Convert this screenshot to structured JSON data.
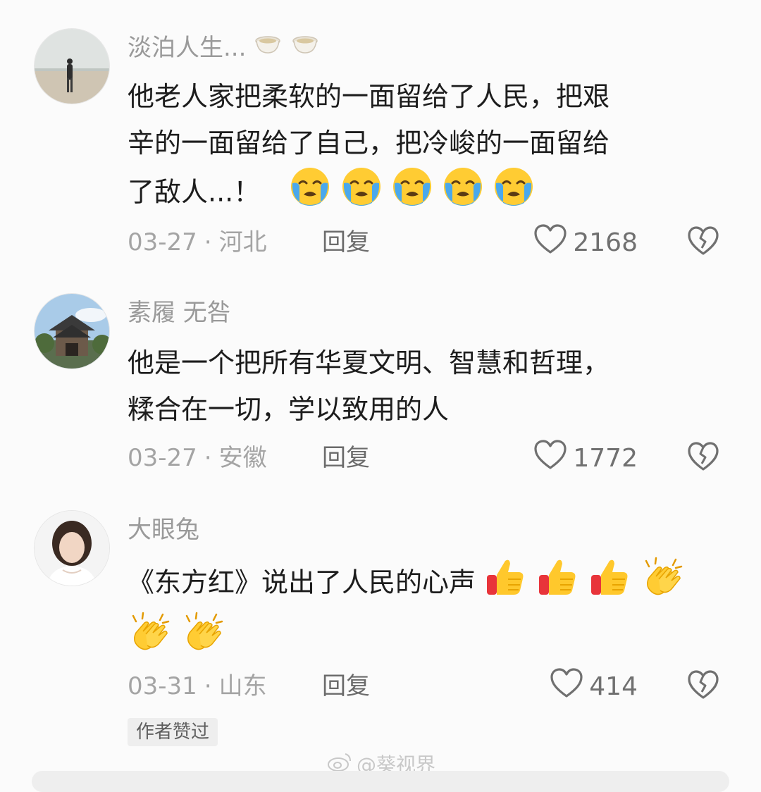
{
  "colors": {
    "background": "#fbfbfb",
    "username": "#9a9a9a",
    "body_text": "#1d1d1d",
    "meta": "#a4a4a4",
    "reply": "#6b6b6b",
    "count": "#707070"
  },
  "comments": [
    {
      "username": "淡泊人生...",
      "username_emojis": [
        "tea-cup-icon",
        "tea-cup-icon"
      ],
      "text_lines": [
        "他老人家把柔软的一面留给了人民，把艰",
        "辛的一面留给了自己，把冷峻的一面留给",
        "了敌人...！"
      ],
      "emojis": [
        "loudly-crying-face-icon",
        "loudly-crying-face-icon",
        "loudly-crying-face-icon",
        "loudly-crying-face-icon",
        "loudly-crying-face-icon"
      ],
      "date": "03-27",
      "location": "河北",
      "reply_label": "回复",
      "likes": "2168"
    },
    {
      "username": "素履 无咎",
      "text_lines": [
        "他是一个把所有华夏文明、智慧和哲理，",
        "糅合在一切，学以致用的人"
      ],
      "date": "03-27",
      "location": "安徽",
      "reply_label": "回复",
      "likes": "1772"
    },
    {
      "username": "大眼兔",
      "text_lines": [
        "《东方红》说出了人民的心声"
      ],
      "emojis_line1": [
        "thumbs-up-icon",
        "thumbs-up-icon",
        "thumbs-up-icon",
        "clapping-hands-icon"
      ],
      "emojis_line2": [
        "clapping-hands-icon",
        "clapping-hands-icon"
      ],
      "date": "03-31",
      "location": "山东",
      "reply_label": "回复",
      "likes": "414",
      "author_tag": "作者赞过"
    }
  ],
  "watermark": "@葵视界",
  "separator": "·"
}
